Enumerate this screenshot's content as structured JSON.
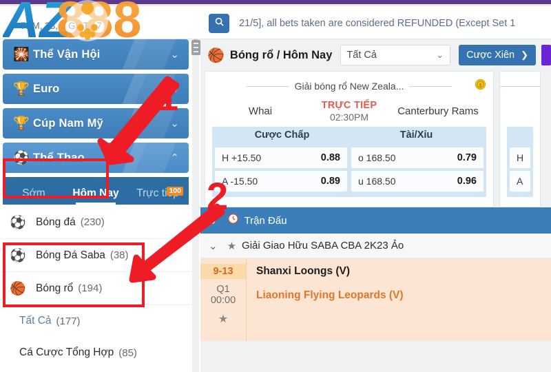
{
  "topbar": {
    "date_text": "7PM, 23, 2   GMT +7",
    "search_icon": "search-icon",
    "marquee": "21/5], all bets taken are considered REFUNDED (Except Set 1"
  },
  "sidebar": {
    "categories": [
      {
        "label": "Thể Vận Hội",
        "icon": "torch-icon",
        "glyph": "🎇",
        "expanded": false
      },
      {
        "label": "Euro",
        "icon": "trophy-cup-icon",
        "glyph": "🏆",
        "expanded": false
      },
      {
        "label": "Cúp Nam Mỹ",
        "icon": "gold-trophy-icon",
        "glyph": "🏆",
        "expanded": false
      },
      {
        "label": "Thể Thao",
        "icon": "sports-ball-icon",
        "glyph": "⚽",
        "expanded": true
      }
    ],
    "tabs": [
      {
        "label": "Sớm",
        "active": false,
        "badge": ""
      },
      {
        "label": "Hôm Nay",
        "active": true,
        "badge": ""
      },
      {
        "label": "Trực tiếp",
        "active": false,
        "badge": "100"
      }
    ],
    "sports": [
      {
        "label": "Bóng đá",
        "count": "(230)",
        "icon": "football-clock-icon",
        "glyph": "⚽"
      },
      {
        "label": "Bóng Đá Saba",
        "count": "(38)",
        "icon": "saba-football-icon",
        "glyph": "⚽"
      },
      {
        "label": "Bóng rổ",
        "count": "(194)",
        "icon": "basketball-clock-icon",
        "glyph": "🏀"
      }
    ],
    "subitems": [
      {
        "label": "Tất Cả",
        "count": "(177)",
        "selected": true
      },
      {
        "label": "Cá Cược Tổng Hợp",
        "count": "(85)",
        "selected": false
      }
    ]
  },
  "main": {
    "header": {
      "icon": "basketball-icon",
      "title": "Bóng rổ / Hôm Nay",
      "filter_value": "Tất Cả",
      "chevron_icon": "chevron-down-icon",
      "parlay_button": "Cược Xiên",
      "parlay_arrow_icon": "chevron-right-icon"
    },
    "cards": [
      {
        "league": "Giải bóng rổ New Zeala...",
        "coin_icon": "coin-dollar-icon",
        "home_team": "Whai",
        "away_team": "Canterbury Rams",
        "status": "TRỰC TIẾP",
        "time": "02:30PM",
        "markets": [
          {
            "title": "Cược Chấp",
            "rows": [
              {
                "label": "H +15.50",
                "value": "0.88"
              },
              {
                "label": "A -15.50",
                "value": "0.89"
              }
            ]
          },
          {
            "title": "Tài/Xỉu",
            "rows": [
              {
                "label": "o 168.50",
                "value": "0.79"
              },
              {
                "label": "u 168.50",
                "value": "0.96"
              }
            ]
          }
        ]
      }
    ],
    "partial_card": {
      "rows": [
        {
          "label": "H"
        },
        {
          "label": "A"
        }
      ]
    },
    "section": {
      "chevron_icon": "chevron-down-icon",
      "clock_icon": "clock-icon",
      "title": "Trận Đấu"
    },
    "league_row": {
      "chevron_icon": "chevron-down-icon",
      "star_icon": "star-icon",
      "title": "Giải Giao Hữu SABA CBA 2K23 Ảo"
    },
    "match": {
      "score": "9-13",
      "period": "Q1",
      "clock": "00:00",
      "star_icon": "star-icon",
      "home_team": "Shanxi Loongs (V)",
      "away_team": "Liaoning Flying Leopards (V)"
    }
  },
  "watermark": {
    "text_az": "AZ",
    "text_888": "888"
  },
  "annotations": [
    {
      "number": "1"
    },
    {
      "number": "2"
    }
  ],
  "colors": {
    "accent_blue": "#3572b0",
    "sidebar_blue": "#4a8cc7",
    "tab_blue": "#2e6da4",
    "annotation_red": "#ee1c25",
    "badge_orange": "#f08a24",
    "live_red": "#e05c4e",
    "away_orange": "#e0762a",
    "match_bg": "#fce6d3",
    "purple": "#5b3a8e"
  }
}
